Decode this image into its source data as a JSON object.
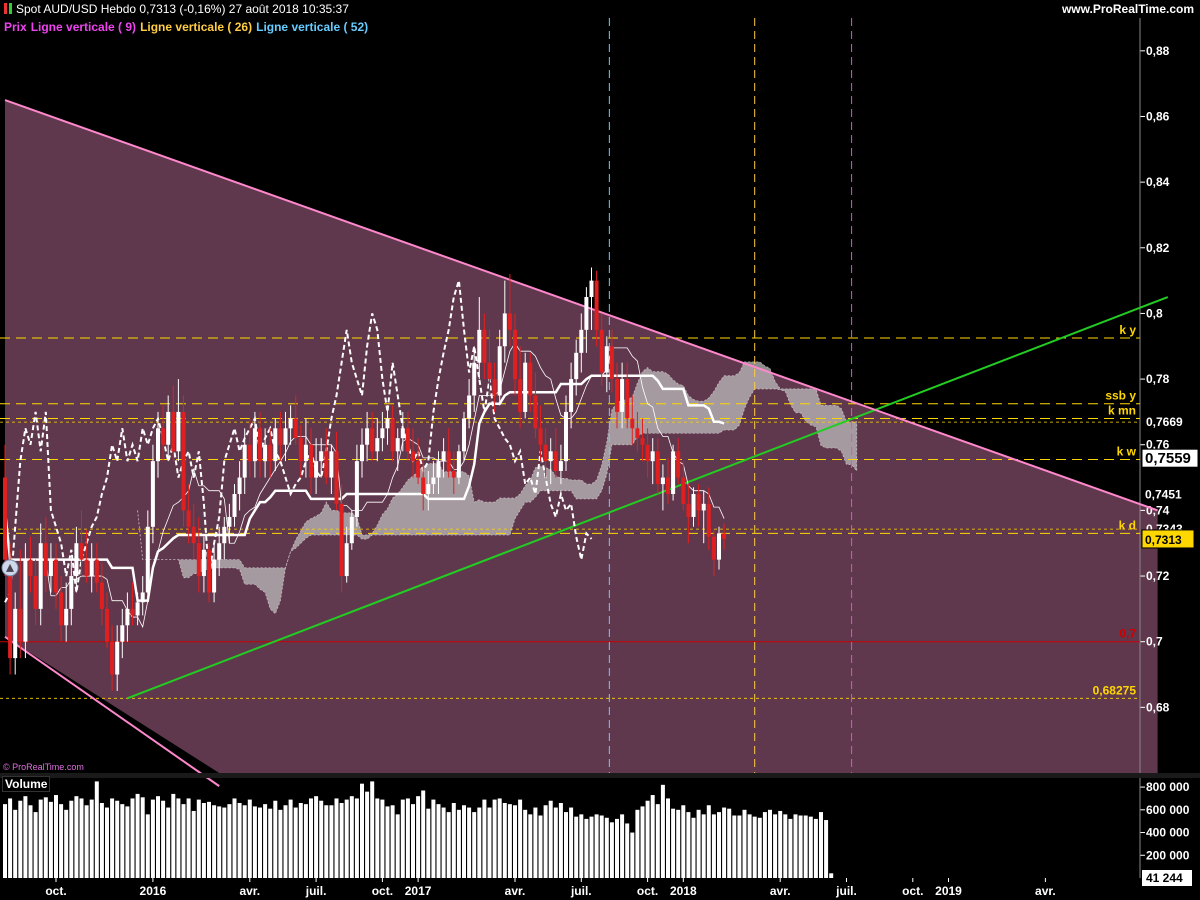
{
  "header": {
    "title": "Spot AUD/USD   Hebdo   0,7313 (-0,16%)   27 août 2018 10:35:37",
    "brand": "www.ProRealTime.com"
  },
  "legend": {
    "prix": "Prix",
    "lv9": "Ligne verticale ( 9)",
    "lv26": "Ligne verticale ( 26)",
    "lv52": "Ligne verticale ( 52)"
  },
  "watermark": "© ProRealTime.com",
  "volume_label": "Volume",
  "colors": {
    "background": "#000000",
    "channel_fill": "#6a3e55",
    "up_candle": "#ffffff",
    "down_candle": "#e02020",
    "trend_up": "#22cc22",
    "trend_down": "#ff88cc",
    "level": "#ffd700",
    "support": "#cc0000",
    "lv9": "#ee44ee",
    "lv26": "#ffcc44",
    "lv52": "#66ccff"
  },
  "chart_data": {
    "type": "candlestick",
    "instrument": "Spot AUD/USD",
    "timeframe": "Hebdo",
    "last": 0.7313,
    "change_pct": -0.16,
    "ylim": [
      0.66,
      0.89
    ],
    "y_ticks": [
      "0,68",
      "0,7",
      "0,72",
      "0,74",
      "0,76",
      "0,78",
      "0,8",
      "0,82",
      "0,84",
      "0,86",
      "0,88"
    ],
    "x_ticks": [
      {
        "label": "oct.",
        "w": 10
      },
      {
        "label": "2016",
        "w": 29
      },
      {
        "label": "avr.",
        "w": 48
      },
      {
        "label": "juil.",
        "w": 61
      },
      {
        "label": "oct.",
        "w": 74
      },
      {
        "label": "2017",
        "w": 81
      },
      {
        "label": "avr.",
        "w": 100
      },
      {
        "label": "juil.",
        "w": 113
      },
      {
        "label": "oct.",
        "w": 126
      },
      {
        "label": "2018",
        "w": 133
      },
      {
        "label": "avr.",
        "w": 152
      },
      {
        "label": "juil.",
        "w": 165
      },
      {
        "label": "oct.",
        "w": 178
      },
      {
        "label": "2019",
        "w": 185
      },
      {
        "label": "avr.",
        "w": 204
      }
    ],
    "price_levels": [
      {
        "label": "k y",
        "value": 0.7925,
        "style": "dash"
      },
      {
        "label": "ssb y",
        "value": 0.7725,
        "style": "dash"
      },
      {
        "label": "k mn",
        "value": 0.768,
        "style": "dash"
      },
      {
        "label": "0,7669",
        "value": 0.7669,
        "style": "dot"
      },
      {
        "label": "k w",
        "value": 0.7555,
        "style": "dash"
      },
      {
        "label": "k d",
        "value": 0.733,
        "style": "dash"
      },
      {
        "label": "0,7343",
        "value": 0.7343,
        "style": "dot"
      },
      {
        "label": "0,7",
        "value": 0.7,
        "style": "solid"
      },
      {
        "label": "0,68275",
        "value": 0.68275,
        "style": "dot"
      }
    ],
    "axis_badges": [
      {
        "label": "0,7559",
        "value": 0.7559,
        "style": "white"
      },
      {
        "label": "0,7451",
        "value": 0.7451,
        "style": "plain"
      },
      {
        "label": "0,7313",
        "value": 0.7313,
        "style": "yellow"
      }
    ],
    "vertical_lines": [
      {
        "name": "Ligne verticale ( 52)",
        "w": 118.5
      },
      {
        "name": "Ligne verticale ( 26)",
        "w": 147
      },
      {
        "name": "Ligne verticale ( 9)",
        "w": 166
      }
    ],
    "trendlines": [
      {
        "name": "support",
        "from": [
          24,
          0.68275
        ],
        "to": [
          228,
          0.805
        ]
      },
      {
        "name": "resistance",
        "from": [
          0,
          0.865
        ],
        "to": [
          226,
          0.74
        ]
      },
      {
        "name": "lower-channel",
        "from": [
          0,
          0.7015
        ],
        "to": [
          42,
          0.656
        ]
      }
    ],
    "candles": [
      [
        0.75,
        0.76,
        0.72,
        0.725
      ],
      [
        0.725,
        0.73,
        0.69,
        0.695
      ],
      [
        0.695,
        0.715,
        0.69,
        0.71
      ],
      [
        0.71,
        0.728,
        0.695,
        0.7
      ],
      [
        0.7,
        0.73,
        0.695,
        0.725
      ],
      [
        0.725,
        0.732,
        0.715,
        0.72
      ],
      [
        0.72,
        0.725,
        0.705,
        0.71
      ],
      [
        0.71,
        0.736,
        0.705,
        0.73
      ],
      [
        0.73,
        0.738,
        0.715,
        0.72
      ],
      [
        0.72,
        0.73,
        0.715,
        0.725
      ],
      [
        0.725,
        0.73,
        0.71,
        0.715
      ],
      [
        0.715,
        0.72,
        0.7,
        0.705
      ],
      [
        0.705,
        0.718,
        0.7,
        0.71
      ],
      [
        0.71,
        0.725,
        0.705,
        0.72
      ],
      [
        0.72,
        0.735,
        0.715,
        0.73
      ],
      [
        0.73,
        0.74,
        0.72,
        0.725
      ],
      [
        0.725,
        0.734,
        0.718,
        0.72
      ],
      [
        0.72,
        0.73,
        0.715,
        0.725
      ],
      [
        0.725,
        0.73,
        0.715,
        0.718
      ],
      [
        0.718,
        0.724,
        0.705,
        0.71
      ],
      [
        0.71,
        0.715,
        0.698,
        0.7
      ],
      [
        0.7,
        0.705,
        0.685,
        0.69
      ],
      [
        0.69,
        0.705,
        0.685,
        0.7
      ],
      [
        0.7,
        0.71,
        0.695,
        0.705
      ],
      [
        0.705,
        0.715,
        0.7,
        0.71
      ],
      [
        0.71,
        0.718,
        0.705,
        0.708
      ],
      [
        0.708,
        0.715,
        0.705,
        0.712
      ],
      [
        0.712,
        0.72,
        0.708,
        0.715
      ],
      [
        0.715,
        0.74,
        0.712,
        0.735
      ],
      [
        0.735,
        0.76,
        0.73,
        0.755
      ],
      [
        0.755,
        0.77,
        0.75,
        0.765
      ],
      [
        0.765,
        0.772,
        0.755,
        0.76
      ],
      [
        0.76,
        0.775,
        0.755,
        0.77
      ],
      [
        0.77,
        0.778,
        0.755,
        0.758
      ],
      [
        0.758,
        0.78,
        0.755,
        0.77
      ],
      [
        0.77,
        0.775,
        0.735,
        0.74
      ],
      [
        0.74,
        0.748,
        0.73,
        0.735
      ],
      [
        0.735,
        0.742,
        0.725,
        0.73
      ],
      [
        0.73,
        0.738,
        0.715,
        0.72
      ],
      [
        0.72,
        0.732,
        0.715,
        0.728
      ],
      [
        0.728,
        0.73,
        0.712,
        0.715
      ],
      [
        0.715,
        0.73,
        0.712,
        0.725
      ],
      [
        0.725,
        0.735,
        0.72,
        0.73
      ],
      [
        0.73,
        0.738,
        0.725,
        0.735
      ],
      [
        0.735,
        0.742,
        0.73,
        0.738
      ],
      [
        0.738,
        0.748,
        0.735,
        0.745
      ],
      [
        0.745,
        0.755,
        0.74,
        0.75
      ],
      [
        0.75,
        0.765,
        0.745,
        0.76
      ],
      [
        0.76,
        0.768,
        0.75,
        0.755
      ],
      [
        0.755,
        0.77,
        0.75,
        0.765
      ],
      [
        0.765,
        0.77,
        0.75,
        0.755
      ],
      [
        0.755,
        0.765,
        0.75,
        0.76
      ],
      [
        0.76,
        0.765,
        0.75,
        0.755
      ],
      [
        0.755,
        0.768,
        0.752,
        0.765
      ],
      [
        0.765,
        0.77,
        0.755,
        0.76
      ],
      [
        0.76,
        0.77,
        0.755,
        0.765
      ],
      [
        0.765,
        0.772,
        0.76,
        0.768
      ],
      [
        0.768,
        0.775,
        0.76,
        0.762
      ],
      [
        0.762,
        0.766,
        0.75,
        0.755
      ],
      [
        0.755,
        0.768,
        0.75,
        0.76
      ],
      [
        0.76,
        0.765,
        0.745,
        0.75
      ],
      [
        0.75,
        0.762,
        0.745,
        0.755
      ],
      [
        0.755,
        0.762,
        0.75,
        0.758
      ],
      [
        0.758,
        0.765,
        0.748,
        0.75
      ],
      [
        0.75,
        0.76,
        0.745,
        0.758
      ],
      [
        0.758,
        0.764,
        0.74,
        0.742
      ],
      [
        0.742,
        0.748,
        0.715,
        0.72
      ],
      [
        0.72,
        0.735,
        0.718,
        0.73
      ],
      [
        0.73,
        0.74,
        0.728,
        0.738
      ],
      [
        0.738,
        0.76,
        0.735,
        0.755
      ],
      [
        0.755,
        0.765,
        0.75,
        0.76
      ],
      [
        0.76,
        0.77,
        0.755,
        0.765
      ],
      [
        0.765,
        0.77,
        0.755,
        0.758
      ],
      [
        0.758,
        0.768,
        0.755,
        0.762
      ],
      [
        0.762,
        0.77,
        0.758,
        0.765
      ],
      [
        0.765,
        0.772,
        0.76,
        0.768
      ],
      [
        0.768,
        0.772,
        0.755,
        0.758
      ],
      [
        0.758,
        0.765,
        0.752,
        0.762
      ],
      [
        0.762,
        0.77,
        0.758,
        0.765
      ],
      [
        0.765,
        0.77,
        0.755,
        0.758
      ],
      [
        0.758,
        0.765,
        0.75,
        0.755
      ],
      [
        0.755,
        0.762,
        0.748,
        0.75
      ],
      [
        0.75,
        0.756,
        0.74,
        0.745
      ],
      [
        0.745,
        0.752,
        0.74,
        0.748
      ],
      [
        0.748,
        0.755,
        0.745,
        0.75
      ],
      [
        0.75,
        0.758,
        0.745,
        0.755
      ],
      [
        0.755,
        0.762,
        0.75,
        0.758
      ],
      [
        0.758,
        0.765,
        0.75,
        0.752
      ],
      [
        0.752,
        0.758,
        0.745,
        0.75
      ],
      [
        0.75,
        0.76,
        0.748,
        0.758
      ],
      [
        0.758,
        0.77,
        0.755,
        0.768
      ],
      [
        0.768,
        0.78,
        0.765,
        0.775
      ],
      [
        0.775,
        0.79,
        0.77,
        0.785
      ],
      [
        0.785,
        0.805,
        0.78,
        0.795
      ],
      [
        0.795,
        0.8,
        0.78,
        0.785
      ],
      [
        0.785,
        0.795,
        0.775,
        0.78
      ],
      [
        0.78,
        0.785,
        0.77,
        0.775
      ],
      [
        0.775,
        0.795,
        0.772,
        0.79
      ],
      [
        0.79,
        0.81,
        0.785,
        0.8
      ],
      [
        0.8,
        0.812,
        0.79,
        0.795
      ],
      [
        0.795,
        0.8,
        0.775,
        0.78
      ],
      [
        0.78,
        0.79,
        0.765,
        0.77
      ],
      [
        0.77,
        0.788,
        0.768,
        0.785
      ],
      [
        0.785,
        0.788,
        0.77,
        0.775
      ],
      [
        0.775,
        0.782,
        0.762,
        0.765
      ],
      [
        0.765,
        0.772,
        0.755,
        0.76
      ],
      [
        0.76,
        0.765,
        0.75,
        0.755
      ],
      [
        0.755,
        0.762,
        0.748,
        0.758
      ],
      [
        0.758,
        0.765,
        0.75,
        0.752
      ],
      [
        0.752,
        0.76,
        0.748,
        0.755
      ],
      [
        0.755,
        0.775,
        0.752,
        0.77
      ],
      [
        0.77,
        0.785,
        0.765,
        0.78
      ],
      [
        0.78,
        0.792,
        0.775,
        0.788
      ],
      [
        0.788,
        0.8,
        0.782,
        0.795
      ],
      [
        0.795,
        0.808,
        0.788,
        0.805
      ],
      [
        0.805,
        0.814,
        0.795,
        0.81
      ],
      [
        0.81,
        0.813,
        0.79,
        0.795
      ],
      [
        0.795,
        0.8,
        0.778,
        0.782
      ],
      [
        0.782,
        0.793,
        0.776,
        0.79
      ],
      [
        0.79,
        0.795,
        0.776,
        0.78
      ],
      [
        0.78,
        0.785,
        0.765,
        0.77
      ],
      [
        0.77,
        0.785,
        0.765,
        0.78
      ],
      [
        0.78,
        0.785,
        0.765,
        0.768
      ],
      [
        0.768,
        0.775,
        0.76,
        0.765
      ],
      [
        0.765,
        0.77,
        0.758,
        0.762
      ],
      [
        0.762,
        0.768,
        0.755,
        0.76
      ],
      [
        0.76,
        0.765,
        0.75,
        0.755
      ],
      [
        0.755,
        0.762,
        0.748,
        0.758
      ],
      [
        0.758,
        0.762,
        0.745,
        0.748
      ],
      [
        0.748,
        0.754,
        0.74,
        0.75
      ],
      [
        0.75,
        0.756,
        0.742,
        0.745
      ],
      [
        0.745,
        0.76,
        0.743,
        0.758
      ],
      [
        0.758,
        0.762,
        0.748,
        0.75
      ],
      [
        0.75,
        0.755,
        0.74,
        0.742
      ],
      [
        0.742,
        0.748,
        0.73,
        0.738
      ],
      [
        0.738,
        0.747,
        0.735,
        0.745
      ],
      [
        0.745,
        0.748,
        0.735,
        0.74
      ],
      [
        0.74,
        0.746,
        0.73,
        0.742
      ],
      [
        0.742,
        0.747,
        0.728,
        0.732
      ],
      [
        0.732,
        0.734,
        0.72,
        0.725
      ],
      [
        0.725,
        0.735,
        0.722,
        0.733
      ],
      [
        0.733,
        0.736,
        0.728,
        0.7313
      ]
    ],
    "volume": {
      "y_ticks": [
        "200 000",
        "400 000",
        "600 000",
        "800 000"
      ],
      "ylim": [
        0,
        880000
      ],
      "last": "41 244",
      "values": [
        650000,
        700000,
        600000,
        680000,
        720000,
        640000,
        580000,
        690000,
        710000,
        670000,
        730000,
        650000,
        600000,
        680000,
        720000,
        700000,
        640000,
        690000,
        850000,
        660000,
        620000,
        700000,
        680000,
        650000,
        630000,
        700000,
        740000,
        710000,
        560000,
        690000,
        720000,
        680000,
        620000,
        740000,
        700000,
        650000,
        700000,
        590000,
        690000,
        660000,
        670000,
        640000,
        630000,
        620000,
        650000,
        700000,
        660000,
        640000,
        690000,
        630000,
        620000,
        650000,
        610000,
        680000,
        600000,
        640000,
        690000,
        620000,
        660000,
        650000,
        700000,
        720000,
        680000,
        640000,
        640000,
        700000,
        660000,
        690000,
        720000,
        700000,
        830000,
        760000,
        850000,
        700000,
        690000,
        630000,
        640000,
        560000,
        690000,
        700000,
        650000,
        720000,
        770000,
        610000,
        690000,
        650000,
        620000,
        580000,
        660000,
        600000,
        640000,
        620000,
        580000,
        620000,
        690000,
        620000,
        690000,
        700000,
        660000,
        650000,
        640000,
        690000,
        600000,
        560000,
        620000,
        550000,
        640000,
        680000,
        620000,
        660000,
        580000,
        620000,
        540000,
        560000,
        520000,
        540000,
        560000,
        550000,
        530000,
        490000,
        520000,
        560000,
        480000,
        400000,
        600000,
        630000,
        680000,
        730000,
        650000,
        820000,
        700000,
        610000,
        600000,
        640000,
        580000,
        530000,
        600000,
        560000,
        640000,
        560000,
        580000,
        620000,
        610000,
        550000,
        550000,
        600000,
        560000,
        540000,
        530000,
        580000,
        600000,
        560000,
        590000,
        560000,
        520000,
        560000,
        550000,
        550000,
        540000,
        520000,
        580000,
        510000,
        41244
      ]
    }
  }
}
